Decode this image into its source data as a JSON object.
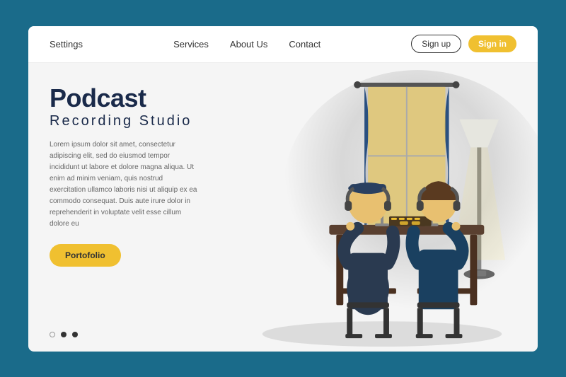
{
  "page": {
    "background_color": "#1a6b8a"
  },
  "navbar": {
    "logo": "Settings",
    "links": [
      {
        "label": "Services",
        "id": "services"
      },
      {
        "label": "About Us",
        "id": "about"
      },
      {
        "label": "Contact",
        "id": "contact"
      }
    ],
    "signup_label": "Sign up",
    "signin_label": "Sign in"
  },
  "hero": {
    "title_main": "Podcast",
    "title_sub": "Recording Studio",
    "description": "Lorem ipsum dolor sit amet, consectetur adipiscing elit, sed do eiusmod tempor incididunt ut labore et dolore magna aliqua. Ut enim ad minim veniam, quis nostrud exercitation ullamco laboris nisi ut aliquip ex ea commodo consequat. Duis aute irure dolor in reprehenderit in voluptate velit esse cillum dolore eu",
    "portfolio_label": "Portofolio"
  },
  "dots": [
    {
      "type": "empty"
    },
    {
      "type": "filled"
    },
    {
      "type": "filled"
    }
  ]
}
